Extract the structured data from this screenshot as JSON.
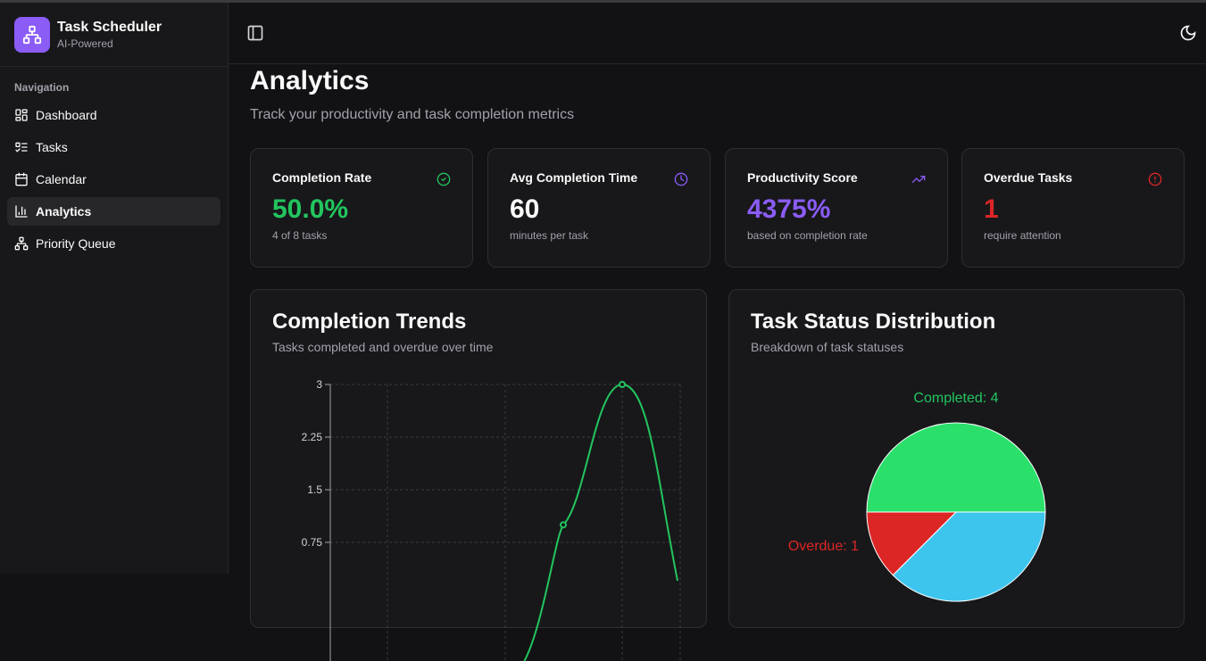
{
  "app": {
    "title": "Task Scheduler",
    "subtitle": "AI-Powered"
  },
  "sidebar": {
    "heading": "Navigation",
    "items": [
      {
        "label": "Dashboard",
        "icon": "dashboard-icon"
      },
      {
        "label": "Tasks",
        "icon": "list-todo-icon"
      },
      {
        "label": "Calendar",
        "icon": "calendar-icon"
      },
      {
        "label": "Analytics",
        "icon": "bar-chart-icon",
        "active": true
      },
      {
        "label": "Priority Queue",
        "icon": "network-icon"
      }
    ]
  },
  "page": {
    "title": "Analytics",
    "subtitle": "Track your productivity and task completion metrics"
  },
  "stats": [
    {
      "label": "Completion Rate",
      "value": "50.0%",
      "note": "4 of 8 tasks",
      "color": "#22c55e",
      "icon": "check-circle-icon"
    },
    {
      "label": "Avg Completion Time",
      "value": "60",
      "note": "minutes per task",
      "color": "#fafafa",
      "icon": "clock-icon"
    },
    {
      "label": "Productivity Score",
      "value": "4375%",
      "note": "based on completion rate",
      "color": "#8b5cf6",
      "icon": "trending-up-icon"
    },
    {
      "label": "Overdue Tasks",
      "value": "1",
      "note": "require attention",
      "color": "#dc2626",
      "icon": "alert-circle-icon"
    }
  ],
  "trends": {
    "title": "Completion Trends",
    "subtitle": "Tasks completed and overdue over time"
  },
  "distribution": {
    "title": "Task Status Distribution",
    "subtitle": "Breakdown of task statuses"
  },
  "chart_data": [
    {
      "type": "line",
      "ylim": [
        0,
        3
      ],
      "yticks": [
        "0.75",
        "1.5",
        "2.25",
        "3"
      ],
      "series": [
        {
          "color": "#22c55e",
          "visible_points": [
            {
              "y": 1
            },
            {
              "y": 3
            }
          ]
        }
      ]
    },
    {
      "type": "pie",
      "slices": [
        {
          "label": "Completed: 4",
          "value": 4,
          "color": "#2ae06b"
        },
        {
          "label": "",
          "value": 3,
          "color": "#3ec5ee"
        },
        {
          "label": "Overdue: 1",
          "value": 1,
          "color": "#dc2626"
        }
      ]
    }
  ]
}
